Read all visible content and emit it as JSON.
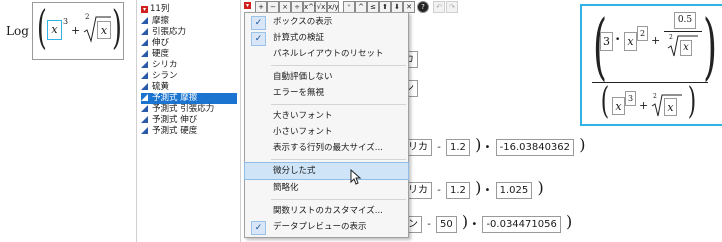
{
  "left_formula": {
    "func": "Log",
    "x": "x",
    "exp": "3",
    "plus": "+",
    "root_index": "2",
    "root_arg": "x"
  },
  "columns": {
    "header": "11列",
    "items": [
      {
        "label": "摩擦"
      },
      {
        "label": "引張応力"
      },
      {
        "label": "伸び"
      },
      {
        "label": "硬度"
      },
      {
        "label": "シリカ"
      },
      {
        "label": "シラン"
      },
      {
        "label": "硫黄"
      },
      {
        "label": "予測式 摩擦",
        "selected": true
      },
      {
        "label": "予測式 引張応力"
      },
      {
        "label": "予測式 伸び"
      },
      {
        "label": "予測式 硬度"
      }
    ]
  },
  "menu": {
    "items": [
      {
        "label": "ボックスの表示",
        "checked": true
      },
      {
        "label": "計算式の検証",
        "checked": true
      },
      {
        "label": "パネルレイアウトのリセット",
        "checked": false
      },
      {
        "label": "自動評価しない",
        "checked": false
      },
      {
        "label": "エラーを無視",
        "checked": false
      },
      {
        "label": "大きいフォント",
        "checked": false
      },
      {
        "label": "小さいフォント",
        "checked": false
      },
      {
        "label": "表示する行列の最大サイズ...",
        "checked": false
      },
      {
        "label": "微分した式",
        "checked": false,
        "highlighted": true
      },
      {
        "label": "簡略化",
        "checked": false
      },
      {
        "label": "関数リストのカスタマイズ...",
        "checked": false
      },
      {
        "label": "データプレビューの表示",
        "checked": true
      }
    ],
    "check_glyph": "✓"
  },
  "background_formula": {
    "frag1": "カ",
    "frag2": "ン",
    "row1": {
      "var": "シリカ",
      "minus": "-",
      "val": "1.2",
      "dot": "•",
      "coef": "-16.03840362"
    },
    "row2": {
      "var": "シリカ",
      "minus": "-",
      "val": "1.2",
      "dot": "•",
      "coef": "1.025"
    },
    "row3": {
      "var": "ラン",
      "minus": "-",
      "val": "50",
      "dot": "•",
      "coef": "-0.034471056"
    }
  },
  "right_formula": {
    "num_a": "3",
    "dot": "•",
    "x": "x",
    "exp": "2",
    "plus": "+",
    "frac_num": "0.5",
    "root_index": "2",
    "root_arg": "x",
    "den_x": "x",
    "den_exp": "3",
    "den_plus": "+",
    "den_root_index": "2",
    "den_root_arg": "x"
  },
  "toolbar": {
    "buttons": [
      "+",
      "−",
      "×",
      "÷",
      "x^y",
      "√x",
      "x/y",
      "⁺",
      "^",
      "≤",
      "⬆",
      "⬇",
      "✕",
      "?",
      "↶",
      "↷"
    ]
  },
  "colors": {
    "accent": "#1b75d0",
    "highlight": "#31b3e6",
    "menu_hl": "#cfe4f7"
  }
}
